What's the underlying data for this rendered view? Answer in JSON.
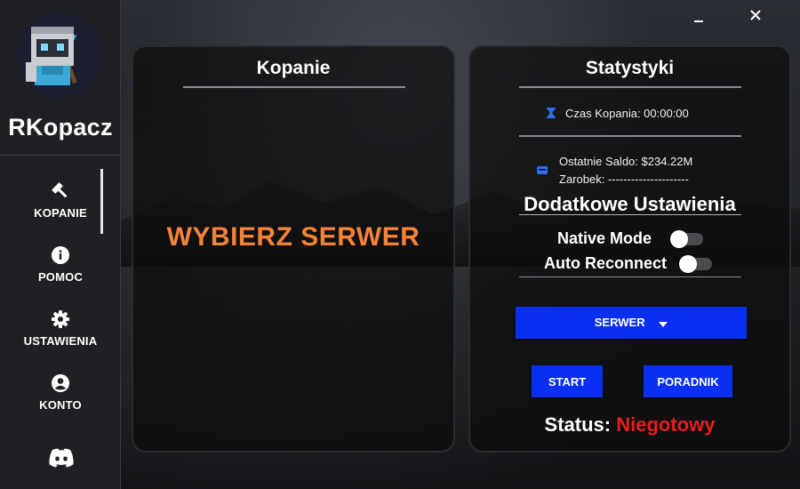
{
  "window": {
    "minimize_label": "–",
    "close_label": "✕"
  },
  "sidebar": {
    "app_name": "RKopacz",
    "items": [
      {
        "label": "KOPANIE",
        "icon": "hammer-icon",
        "active": true
      },
      {
        "label": "POMOC",
        "icon": "info-icon"
      },
      {
        "label": "USTAWIENIA",
        "icon": "gear-icon"
      },
      {
        "label": "KONTO",
        "icon": "account-icon"
      }
    ],
    "footer_icon": "discord-icon"
  },
  "left_panel": {
    "title": "Kopanie",
    "message": "WYBIERZ SERWER",
    "message_color": "#f4833a"
  },
  "right_panel": {
    "title": "Statystyki",
    "mining_time": "Czas Kopania: 00:00:00",
    "last_balance": "Ostatnie Saldo: $234.22M",
    "earnings": "Zarobek: ---------------------",
    "settings_title": "Dodatkowe Ustawienia",
    "toggles": [
      {
        "label": "Native Mode",
        "on": false
      },
      {
        "label": "Auto Reconnect",
        "on": false
      }
    ],
    "server_dropdown": {
      "label": "SERWER",
      "icon": "caret-down-icon"
    },
    "start_label": "START",
    "guide_label": "PORADNIK",
    "status_label": "Status:",
    "status_value": "Niegotowy",
    "status_color": "#e81d1d",
    "accent_color": "#0a2ff0"
  }
}
